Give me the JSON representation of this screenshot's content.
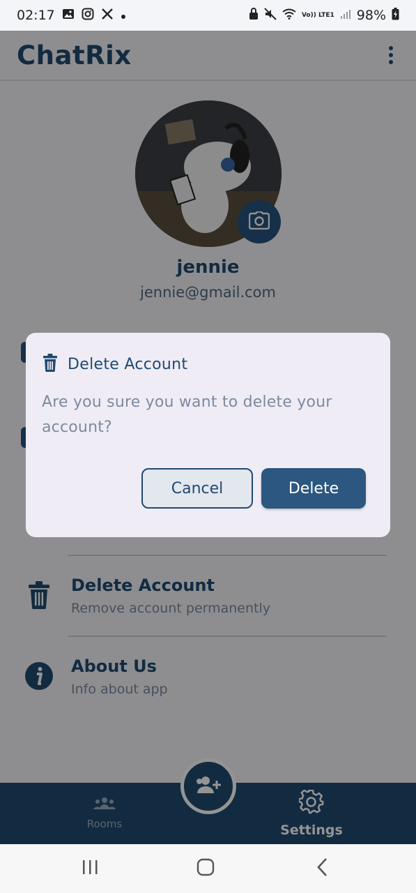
{
  "status_bar": {
    "time": "02:17",
    "battery": "98%",
    "left_icons": [
      "gallery-icon",
      "instagram-icon",
      "x-icon",
      "dot-icon"
    ],
    "right_icons": [
      "lock-icon",
      "mute-icon",
      "wifi-icon",
      "volte-icon",
      "signal-icon",
      "battery-icon"
    ],
    "network_label": "Vo)) LTE1"
  },
  "app_bar": {
    "title": "ChatRix",
    "menu_icon": "more-vert-icon"
  },
  "profile": {
    "name": "jennie",
    "email": "jennie@gmail.com",
    "avatar_icon": "avatar-image",
    "camera_icon": "camera-icon"
  },
  "settings": {
    "items": [
      {
        "title": "Delete Account",
        "subtitle": "Remove account permanently",
        "icon": "trash-icon"
      },
      {
        "title": "About Us",
        "subtitle": "Info about app",
        "icon": "info-icon"
      }
    ]
  },
  "bottom_nav": {
    "items": [
      {
        "label": "Rooms",
        "icon": "group-icon"
      },
      {
        "label": "Settings",
        "icon": "gear-icon"
      }
    ],
    "fab_icon": "add-user-icon"
  },
  "dialog": {
    "title": "Delete Account",
    "icon": "trash-icon",
    "message": "Are you sure you want to delete your account?",
    "cancel_label": "Cancel",
    "confirm_label": "Delete"
  },
  "system_nav": {
    "icons": [
      "recents-icon",
      "home-icon",
      "back-icon"
    ]
  },
  "colors": {
    "primary": "#1f4a70",
    "dialog_bg": "#efecf5",
    "muted_text": "#7d8aa0"
  }
}
